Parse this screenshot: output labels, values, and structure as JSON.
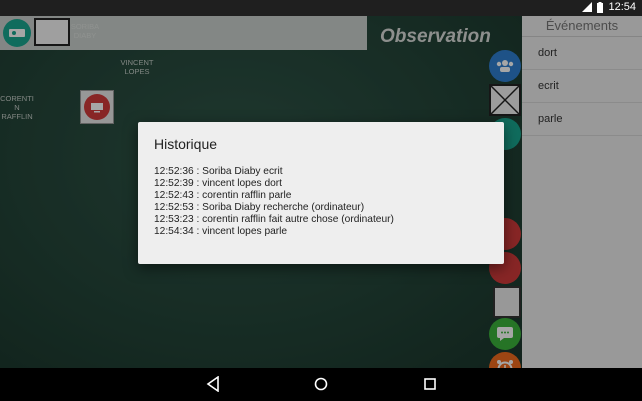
{
  "status_bar": {
    "time": "12:54",
    "icons": [
      "signal-icon",
      "battery-icon"
    ]
  },
  "board": {
    "title": "Observation",
    "students": [
      {
        "name_line1": "SORIBA",
        "name_line2": "DIABY"
      },
      {
        "name_line1": "VINCENT",
        "name_line2": "LOPES"
      },
      {
        "name_line1": "CORENTI",
        "name_line2": "N",
        "name_line3": "RAFFLIN"
      }
    ]
  },
  "events_panel": {
    "header": "Événements",
    "items": [
      "dort",
      "ecrit",
      "parle"
    ]
  },
  "dialog": {
    "title": "Historique",
    "entries": [
      "12:52:36 : Soriba Diaby ecrit",
      "12:52:39 : vincent lopes dort",
      "12:52:43 : corentin rafflin parle",
      "12:52:53 : Soriba Diaby recherche (ordinateur)",
      "12:53:23 : corentin rafflin fait autre chose (ordinateur)",
      "12:54:34 : vincent lopes parle"
    ]
  },
  "colors": {
    "board": "#244539",
    "teal": "#1aa68f",
    "blue": "#2e7fd0",
    "red": "#d23b3b",
    "green": "#3bb23b",
    "orange": "#f06a1e"
  }
}
